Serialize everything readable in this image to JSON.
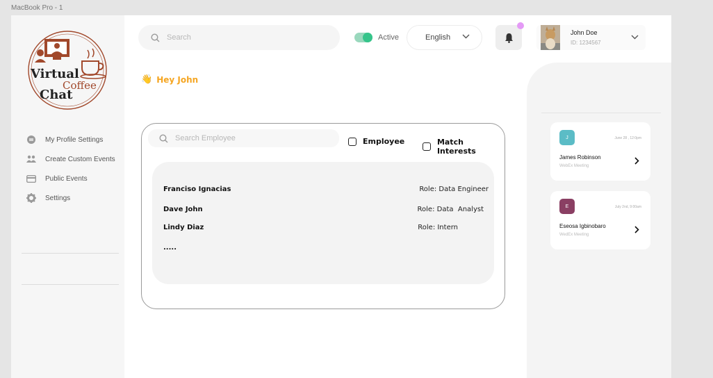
{
  "frame_label": "MacBook Pro - 1",
  "logo": {
    "line1": "Virtual",
    "line2": "Coffee",
    "line3": "Chat",
    "color": "#a1482b"
  },
  "sidebar": {
    "items": [
      {
        "label": "My Profile Settings",
        "icon": "profile-settings-icon"
      },
      {
        "label": "Create Custom Events",
        "icon": "group-icon"
      },
      {
        "label": "Public Events",
        "icon": "card-icon"
      },
      {
        "label": "Settings",
        "icon": "gear-icon"
      }
    ]
  },
  "header": {
    "search_placeholder": "Search",
    "status_label": "Active",
    "status_on": true,
    "language": "English",
    "notification_dot_color": "#e49af6",
    "user": {
      "name": "John Doe",
      "id": "ID: 1234567"
    }
  },
  "greeting": {
    "emoji": "👋",
    "text": "Hey John",
    "color": "#f5a623"
  },
  "employee_panel": {
    "search_placeholder": "Search Employee",
    "filters": [
      {
        "label": "Employee",
        "checked": false
      },
      {
        "label": "Match Interests",
        "checked": false
      }
    ],
    "employees": [
      {
        "name": "Franciso Ignacias",
        "role": "Role: Data Engineer"
      },
      {
        "name": "Dave John",
        "role": "Role: Data  Analyst"
      },
      {
        "name": "Lindy Diaz",
        "role": "Role: Intern"
      }
    ],
    "more": "....."
  },
  "meetings": [
    {
      "initial": "J",
      "color": "#5bbcc6",
      "date": "June 28 , 12:0pm",
      "name": "James Robinson",
      "type": "WebEx Meeting"
    },
    {
      "initial": "E",
      "color": "#8a3f63",
      "date": "July 2nd, 9:00am",
      "name": "Eseosa Igbinobaro",
      "type": "WedEx Meeting"
    }
  ]
}
